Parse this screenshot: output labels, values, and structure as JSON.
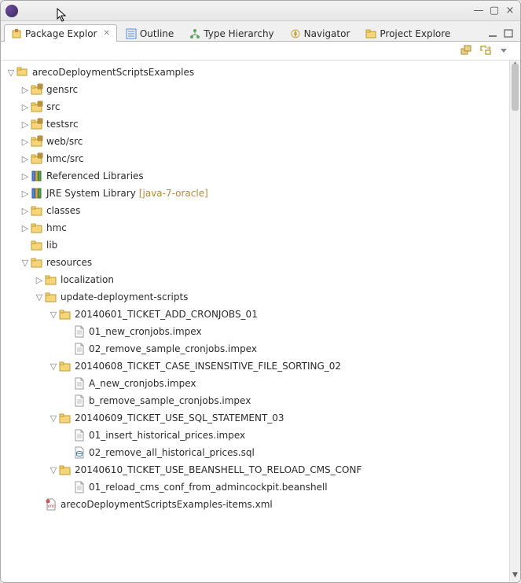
{
  "tabs": [
    {
      "label": "Package Explor",
      "icon": "pkg",
      "active": true,
      "closable": true
    },
    {
      "label": "Outline",
      "icon": "outline"
    },
    {
      "label": "Type Hierarchy",
      "icon": "hierarchy"
    },
    {
      "label": "Navigator",
      "icon": "navigator"
    },
    {
      "label": "Project Explore",
      "icon": "project"
    }
  ],
  "tree": [
    {
      "d": 0,
      "e": "open",
      "icon": "project",
      "label": "arecoDeploymentScriptsExamples"
    },
    {
      "d": 1,
      "e": "closed",
      "icon": "srcfolder",
      "label": "gensrc"
    },
    {
      "d": 1,
      "e": "closed",
      "icon": "srcfolder",
      "label": "src"
    },
    {
      "d": 1,
      "e": "closed",
      "icon": "srcfolder",
      "label": "testsrc"
    },
    {
      "d": 1,
      "e": "closed",
      "icon": "srcfolder",
      "label": "web/src"
    },
    {
      "d": 1,
      "e": "closed",
      "icon": "srcfolder",
      "label": "hmc/src"
    },
    {
      "d": 1,
      "e": "closed",
      "icon": "library",
      "label": "Referenced Libraries"
    },
    {
      "d": 1,
      "e": "closed",
      "icon": "library",
      "label": "JRE System Library",
      "suffix": "[java-7-oracle]"
    },
    {
      "d": 1,
      "e": "closed",
      "icon": "folder",
      "label": "classes"
    },
    {
      "d": 1,
      "e": "closed",
      "icon": "folder",
      "label": "hmc"
    },
    {
      "d": 1,
      "e": "leaf",
      "icon": "folder",
      "label": "lib"
    },
    {
      "d": 1,
      "e": "open",
      "icon": "folder",
      "label": "resources"
    },
    {
      "d": 2,
      "e": "closed",
      "icon": "folder",
      "label": "localization"
    },
    {
      "d": 2,
      "e": "open",
      "icon": "folder",
      "label": "update-deployment-scripts"
    },
    {
      "d": 3,
      "e": "open",
      "icon": "folder",
      "label": "20140601_TICKET_ADD_CRONJOBS_01"
    },
    {
      "d": 4,
      "e": "leaf",
      "icon": "file",
      "label": "01_new_cronjobs.impex"
    },
    {
      "d": 4,
      "e": "leaf",
      "icon": "file",
      "label": "02_remove_sample_cronjobs.impex"
    },
    {
      "d": 3,
      "e": "open",
      "icon": "folder",
      "label": "20140608_TICKET_CASE_INSENSITIVE_FILE_SORTING_02"
    },
    {
      "d": 4,
      "e": "leaf",
      "icon": "file",
      "label": "A_new_cronjobs.impex"
    },
    {
      "d": 4,
      "e": "leaf",
      "icon": "file",
      "label": "b_remove_sample_cronjobs.impex"
    },
    {
      "d": 3,
      "e": "open",
      "icon": "folder",
      "label": "20140609_TICKET_USE_SQL_STATEMENT_03"
    },
    {
      "d": 4,
      "e": "leaf",
      "icon": "file",
      "label": "01_insert_historical_prices.impex"
    },
    {
      "d": 4,
      "e": "leaf",
      "icon": "sql",
      "label": "02_remove_all_historical_prices.sql"
    },
    {
      "d": 3,
      "e": "open",
      "icon": "folder",
      "label": "20140610_TICKET_USE_BEANSHELL_TO_RELOAD_CMS_CONF"
    },
    {
      "d": 4,
      "e": "leaf",
      "icon": "file",
      "label": "01_reload_cms_conf_from_admincockpit.beanshell"
    },
    {
      "d": 2,
      "e": "leaf",
      "icon": "xml",
      "label": "arecoDeploymentScriptsExamples-items.xml"
    }
  ]
}
